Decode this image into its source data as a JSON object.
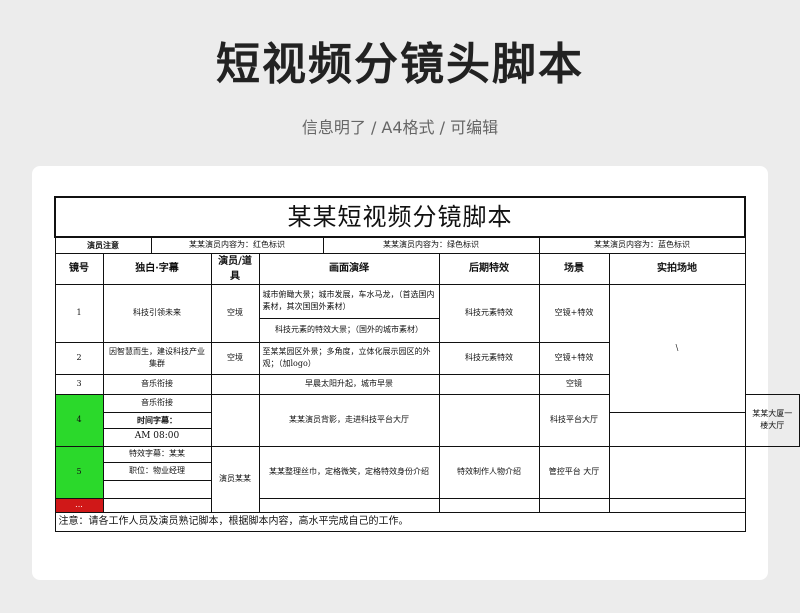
{
  "header": {
    "title": "短视频分镜头脚本",
    "subtitle": "信息明了 / A4格式 / 可编辑"
  },
  "sheet": {
    "title": "某某短视频分镜脚本",
    "notes": {
      "label": "演员注意",
      "red": "某某演员内容为：红色标识",
      "green": "某某演员内容为：绿色标识",
      "blue": "某某演员内容为：蓝色标识"
    },
    "columns": [
      "镜号",
      "独白·字幕",
      "演员/道具",
      "画面演绎",
      "后期特效",
      "场景",
      "实拍场地"
    ],
    "rows": {
      "r1": {
        "no": "1",
        "line": "科技引领未来",
        "actor": "空境",
        "scene_a": "城市俯瞰大景；城市发展，车水马龙，（首选国内素材，其次国国外素材）",
        "scene_b": "科技元素的特效大景；（国外的城市素材）",
        "effect": "科技元素特效",
        "set": "空镜+特效",
        "location": "\\"
      },
      "r2": {
        "no": "2",
        "line": "因智慧而生，建设科技产业集群",
        "actor": "空境",
        "scene": "至某某园区外景；多角度，立体化展示园区的外观；（加logo）",
        "effect": "科技元素特效",
        "set": "空镜+特效"
      },
      "r3": {
        "no": "3",
        "line": "音乐衔接",
        "scene": "早晨太阳升起，城市早景",
        "set": "空镜"
      },
      "r4": {
        "no": "4",
        "line_a": "音乐衔接",
        "line_b": "时间字幕：",
        "line_c": "AM 08:00",
        "scene": "某某演员背影，走进科技平台大厅",
        "set": "科技平台大厅",
        "location": "某某大厦一楼大厅"
      },
      "r5": {
        "no": "5",
        "line_a": "特效字幕：某某",
        "line_b": "职位：物业经理",
        "actor": "演员某某",
        "scene": "某某整理丝巾，定格微笑，定格特效身份介绍",
        "effect": "特效制作人物介绍",
        "set": "管控平台 大厅"
      },
      "r6": {
        "no": "..."
      }
    },
    "footer": "注意：请各工作人员及演员熟记脚本，根据脚本内容，高水平完成自己的工作。"
  },
  "colors": {
    "green": "#2bd92b",
    "red": "#d01818"
  }
}
